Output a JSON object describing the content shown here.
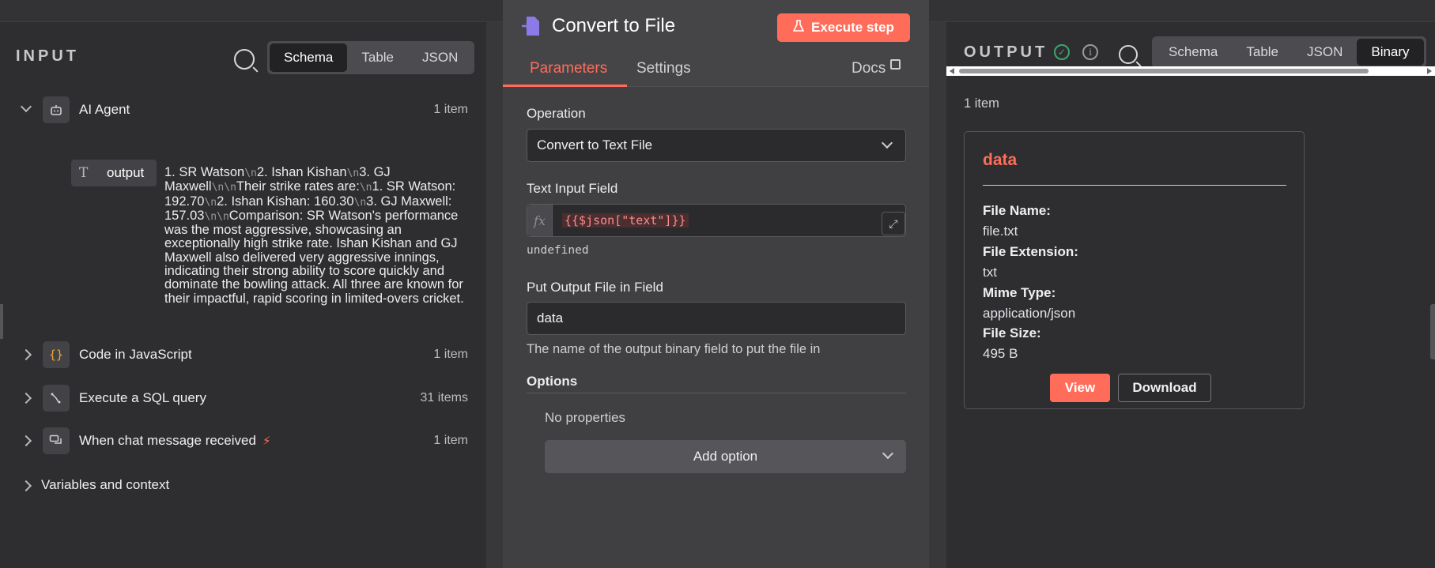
{
  "input": {
    "title": "INPUT",
    "view_tabs": [
      "Schema",
      "Table",
      "JSON"
    ],
    "active_tab": "Schema",
    "nodes": [
      {
        "name": "AI Agent",
        "count": "1 item",
        "icon": "robot-icon",
        "expanded": true
      },
      {
        "name": "Code in JavaScript",
        "count": "1 item",
        "icon": "braces-icon"
      },
      {
        "name": "Execute a SQL query",
        "count": "31 items",
        "icon": "database-icon"
      },
      {
        "name": "When chat message received",
        "count": "1 item",
        "icon": "chat-icon",
        "trigger": true
      }
    ],
    "output_field": {
      "type_icon": "T",
      "name": "output",
      "segments": [
        {
          "text": "1. SR Watson",
          "nl": false
        },
        {
          "text": "\\n",
          "nl": true
        },
        {
          "text": "2. Ishan Kishan",
          "nl": false
        },
        {
          "text": "\\n",
          "nl": true
        },
        {
          "text": "3. GJ Maxwell",
          "nl": false
        },
        {
          "text": "\\n",
          "nl": true
        },
        {
          "text": "\\n",
          "nl": true
        },
        {
          "text": "Their strike rates are:",
          "nl": false
        },
        {
          "text": "\\n",
          "nl": true
        },
        {
          "text": "1. SR Watson: 192.70",
          "nl": false
        },
        {
          "text": "\\n",
          "nl": true
        },
        {
          "text": "2. Ishan Kishan: 160.30",
          "nl": false
        },
        {
          "text": "\\n",
          "nl": true
        },
        {
          "text": "3. GJ Maxwell: 157.03",
          "nl": false
        },
        {
          "text": "\\n",
          "nl": true
        },
        {
          "text": "\\n",
          "nl": true
        },
        {
          "text": "Comparison: SR Watson's performance was the most aggressive, showcasing an exceptionally high strike rate. Ishan Kishan and GJ Maxwell also delivered very aggressive innings, indicating their strong ability to score quickly and dominate the bowling attack. All three are known for their impactful, rapid scoring in limited-overs cricket.",
          "nl": false
        }
      ]
    },
    "variables_label": "Variables and context"
  },
  "node": {
    "title": "Convert to File",
    "execute_label": "Execute step",
    "tabs": {
      "parameters": "Parameters",
      "settings": "Settings",
      "docs": "Docs"
    },
    "operation_label": "Operation",
    "operation_value": "Convert to Text File",
    "text_field_label": "Text Input Field",
    "text_field_expr": "{{$json[\"text\"]}}",
    "text_field_preview": "undefined",
    "output_field_label": "Put Output File in Field",
    "output_field_value": "data",
    "output_field_hint": "The name of the output binary field to put the file in",
    "options_label": "Options",
    "no_properties": "No properties",
    "add_option": "Add option"
  },
  "output": {
    "title": "OUTPUT",
    "view_tabs": [
      "Schema",
      "Table",
      "JSON",
      "Binary"
    ],
    "active_tab": "Binary",
    "item_count": "1 item",
    "binary": {
      "title": "data",
      "file_name_label": "File Name:",
      "file_name": "file.txt",
      "file_ext_label": "File Extension:",
      "file_ext": "txt",
      "mime_label": "Mime Type:",
      "mime": "application/json",
      "size_label": "File Size:",
      "size": "495 B",
      "view_label": "View",
      "download_label": "Download"
    }
  },
  "colors": {
    "accent": "#ff6d5a",
    "success": "#3ca66b"
  }
}
